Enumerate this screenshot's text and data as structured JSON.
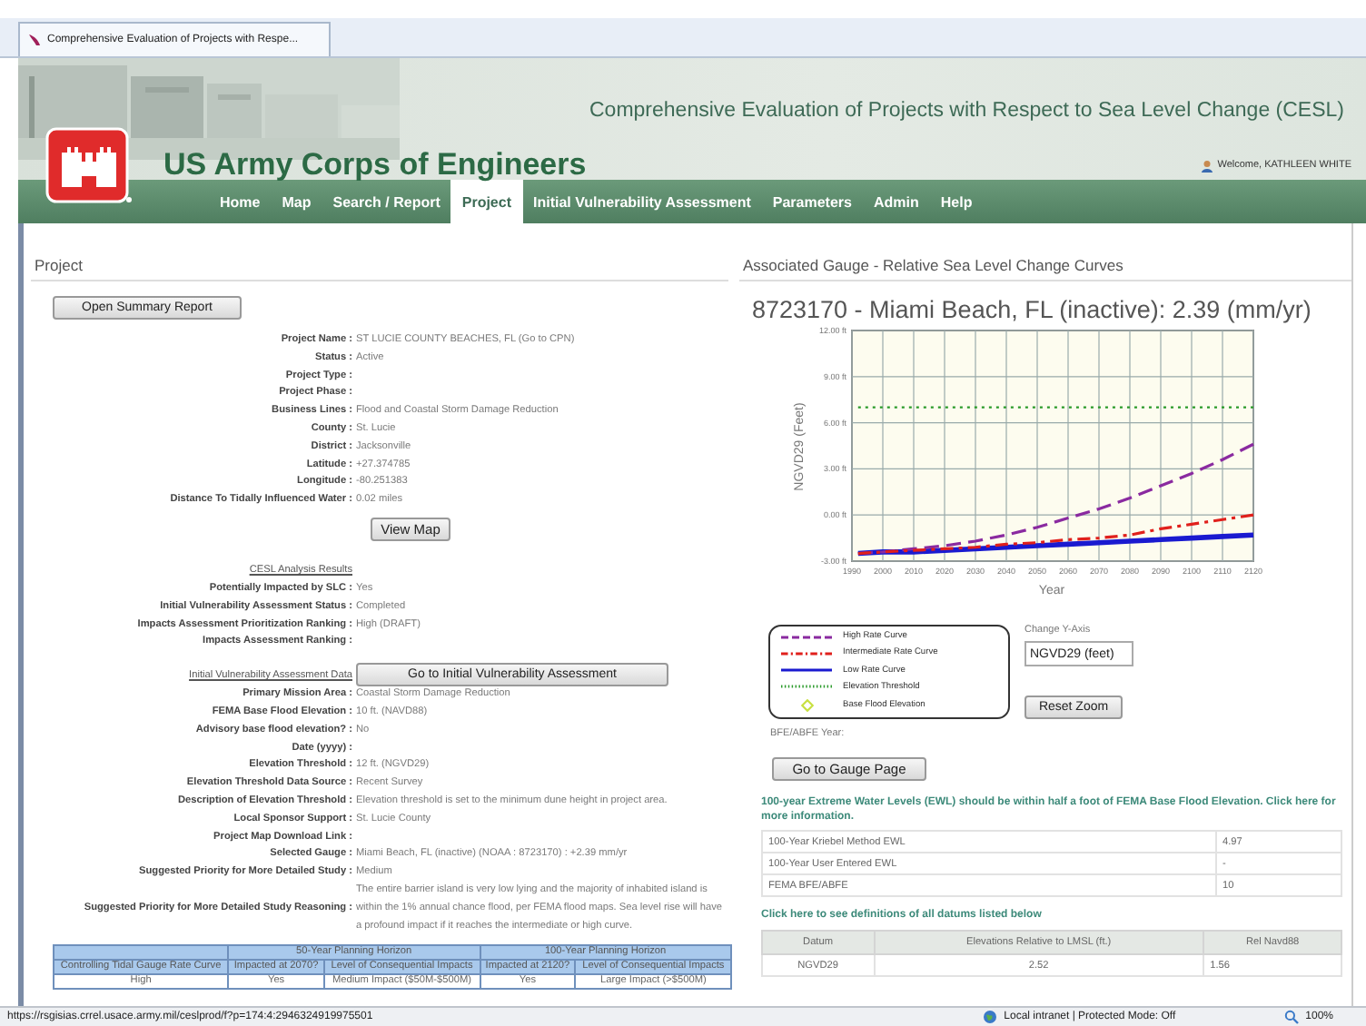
{
  "browser_tab": {
    "title": "Comprehensive Evaluation of Projects with Respe..."
  },
  "header": {
    "app_title": "Comprehensive Evaluation of Projects with Respect to Sea Level Change (CESL)",
    "org_name": "US Army Corps of Engineers",
    "welcome": "Welcome, KATHLEEN WHITE"
  },
  "nav": [
    {
      "label": "Home",
      "selected": false
    },
    {
      "label": "Map",
      "selected": false
    },
    {
      "label": "Search / Report",
      "selected": false
    },
    {
      "label": "Project",
      "selected": true
    },
    {
      "label": "Initial Vulnerability Assessment",
      "selected": false
    },
    {
      "label": "Parameters",
      "selected": false
    },
    {
      "label": "Admin",
      "selected": false
    },
    {
      "label": "Help",
      "selected": false
    }
  ],
  "project": {
    "heading": "Project",
    "summary_button": "Open Summary Report",
    "details": [
      {
        "label": "Project Name :",
        "value": "ST LUCIE COUNTY BEACHES, FL (Go to CPN)"
      },
      {
        "label": "Status :",
        "value": "Active"
      },
      {
        "label": "Project Type :"
      },
      {
        "label": "Project Phase :"
      },
      {
        "label": "Business Lines :",
        "value": "Flood and Coastal Storm Damage Reduction"
      },
      {
        "label": "County :",
        "value": "St. Lucie"
      },
      {
        "label": "District :",
        "value": "Jacksonville"
      },
      {
        "label": "Latitude :",
        "value": "+27.374785"
      },
      {
        "label": "Longitude :",
        "value": "-80.251383"
      },
      {
        "label": "Distance To Tidally Influenced Water :",
        "value": "0.02 miles"
      }
    ],
    "view_map_button": "View Map",
    "analysis": {
      "heading": "CESL Analysis Results",
      "rows": [
        {
          "label": "Potentially Impacted by SLC :",
          "value": "Yes"
        },
        {
          "label": "Initial Vulnerability Assessment Status :",
          "value": "Completed"
        },
        {
          "label": "Impacts Assessment Prioritization Ranking :",
          "value": "High (DRAFT)"
        },
        {
          "label": "Impacts Assessment Ranking :"
        }
      ]
    },
    "assessment": {
      "heading": "Initial Vulnerability Assessment Data",
      "button": "Go to Initial Vulnerability Assessment",
      "rows": [
        {
          "label": "Primary Mission Area :",
          "value": "Coastal Storm Damage Reduction"
        },
        {
          "label": "FEMA Base Flood Elevation :",
          "value": "10 ft. (NAVD88)"
        },
        {
          "label": "Advisory base flood elevation? :",
          "value": "No"
        },
        {
          "label": "Date (yyyy) :"
        },
        {
          "label": "Elevation Threshold :",
          "value": "12 ft. (NGVD29)"
        },
        {
          "label": "Elevation Threshold Data Source :",
          "value": "Recent Survey"
        },
        {
          "label": "Description of Elevation Threshold :",
          "value": "Elevation threshold is set to the minimum dune height in project area."
        },
        {
          "label": "Local Sponsor Support :",
          "value": "St. Lucie County"
        },
        {
          "label": "Project Map Download Link :"
        },
        {
          "label": "Selected Gauge :",
          "value": "Miami Beach, FL (inactive) (NOAA : 8723170) : +2.39 mm/yr"
        },
        {
          "label": "Suggested Priority for More Detailed Study :",
          "value": "Medium"
        },
        {
          "label": "Suggested Priority for More Detailed Study Reasoning :",
          "value": "The entire barrier island is very low lying and the majority of inhabited island is within the 1% annual chance flood, per FEMA flood maps. Sea level rise will have a profound impact if it reaches the intermediate or high curve."
        }
      ]
    },
    "horizon_table": {
      "groups": [
        "50-Year Planning Horizon",
        "100-Year Planning Horizon"
      ],
      "columns": [
        "Controlling Tidal Gauge Rate Curve",
        "Impacted at 2070?",
        "Level of Consequential Impacts",
        "Impacted at 2120?",
        "Level of Consequential Impacts"
      ],
      "rows": [
        [
          "High",
          "Yes",
          "Medium Impact ($50M-$500M)",
          "Yes",
          "Large Impact (>$500M)"
        ]
      ]
    }
  },
  "gauge": {
    "heading": "Associated Gauge - Relative Sea Level Change Curves",
    "chart_data": {
      "type": "line",
      "title": "8723170 - Miami Beach, FL (inactive): 2.39 (mm/yr)",
      "xlabel": "Year",
      "ylabel": "NGVD29 (Feet)",
      "x": [
        1992,
        2000,
        2010,
        2020,
        2030,
        2040,
        2050,
        2060,
        2070,
        2080,
        2090,
        2100,
        2110,
        2120
      ],
      "series": [
        {
          "name": "High Rate Curve",
          "color": "#8a2aa0",
          "line_style": "dashed",
          "values": [
            -2.5,
            -2.4,
            -2.2,
            -2.0,
            -1.7,
            -1.3,
            -0.8,
            -0.2,
            0.4,
            1.1,
            1.9,
            2.7,
            3.6,
            4.6
          ]
        },
        {
          "name": "Intermediate Rate Curve",
          "color": "#e0201c",
          "line_style": "dashdot",
          "values": [
            -2.5,
            -2.4,
            -2.3,
            -2.2,
            -2.1,
            -1.9,
            -1.8,
            -1.6,
            -1.5,
            -1.3,
            -0.9,
            -0.6,
            -0.3,
            0.0
          ]
        },
        {
          "name": "Low Rate Curve",
          "color": "#1a1ad0",
          "line_style": "solid",
          "values": [
            -2.5,
            -2.4,
            -2.4,
            -2.3,
            -2.2,
            -2.1,
            -2.0,
            -1.9,
            -1.8,
            -1.7,
            -1.6,
            -1.5,
            -1.4,
            -1.3
          ]
        },
        {
          "name": "Elevation Threshold",
          "color": "#2a9a2a",
          "line_style": "dotted",
          "values": [
            7,
            7,
            7,
            7,
            7,
            7,
            7,
            7,
            7,
            7,
            7,
            7,
            7,
            7
          ]
        }
      ],
      "grid": true,
      "xlim": [
        1990,
        2120
      ],
      "ylim": [
        -3,
        12
      ],
      "xticks": [
        1990,
        2000,
        2010,
        2020,
        2030,
        2040,
        2050,
        2060,
        2070,
        2080,
        2090,
        2100,
        2110,
        2120
      ],
      "yticks": [
        {
          "value": -3,
          "label": "-3.00 ft"
        },
        {
          "value": 0,
          "label": "0.00 ft"
        },
        {
          "value": 3,
          "label": "3.00 ft"
        },
        {
          "value": 6,
          "label": "6.00 ft"
        },
        {
          "value": 9,
          "label": "9.00 ft"
        },
        {
          "value": 12,
          "label": "12.00 ft"
        }
      ]
    },
    "legend_marker": {
      "label": "Base Flood Elevation",
      "color": "#c8e040"
    },
    "y_axis_label": "Change Y-Axis",
    "y_axis_value": "NGVD29 (feet)",
    "reset_button": "Reset Zoom",
    "bfe_year": "BFE/ABFE Year:",
    "gauge_button": "Go to Gauge Page",
    "notice": "100-year Extreme Water Levels (EWL) should be within half a foot of FEMA Base Flood Elevation. Click here for more information.",
    "ewl_rows": [
      [
        "100-Year Kriebel Method EWL",
        "4.97"
      ],
      [
        "100-Year User Entered EWL",
        "-"
      ],
      [
        "FEMA BFE/ABFE",
        "10"
      ]
    ],
    "datum_link": "Click here to see definitions of all datums listed below",
    "datum_columns": [
      "Datum",
      "Elevations Relative to LMSL (ft.)",
      "Rel Navd88"
    ],
    "datum_rows": [
      [
        "NGVD29",
        "2.52",
        "1.56"
      ]
    ]
  },
  "status_bar": {
    "url": "https://rsgisias.crrel.usace.army.mil/ceslprod/f?p=174:4:2946324919975501",
    "zone": "Local intranet | Protected Mode: Off",
    "zoom": "100%"
  }
}
